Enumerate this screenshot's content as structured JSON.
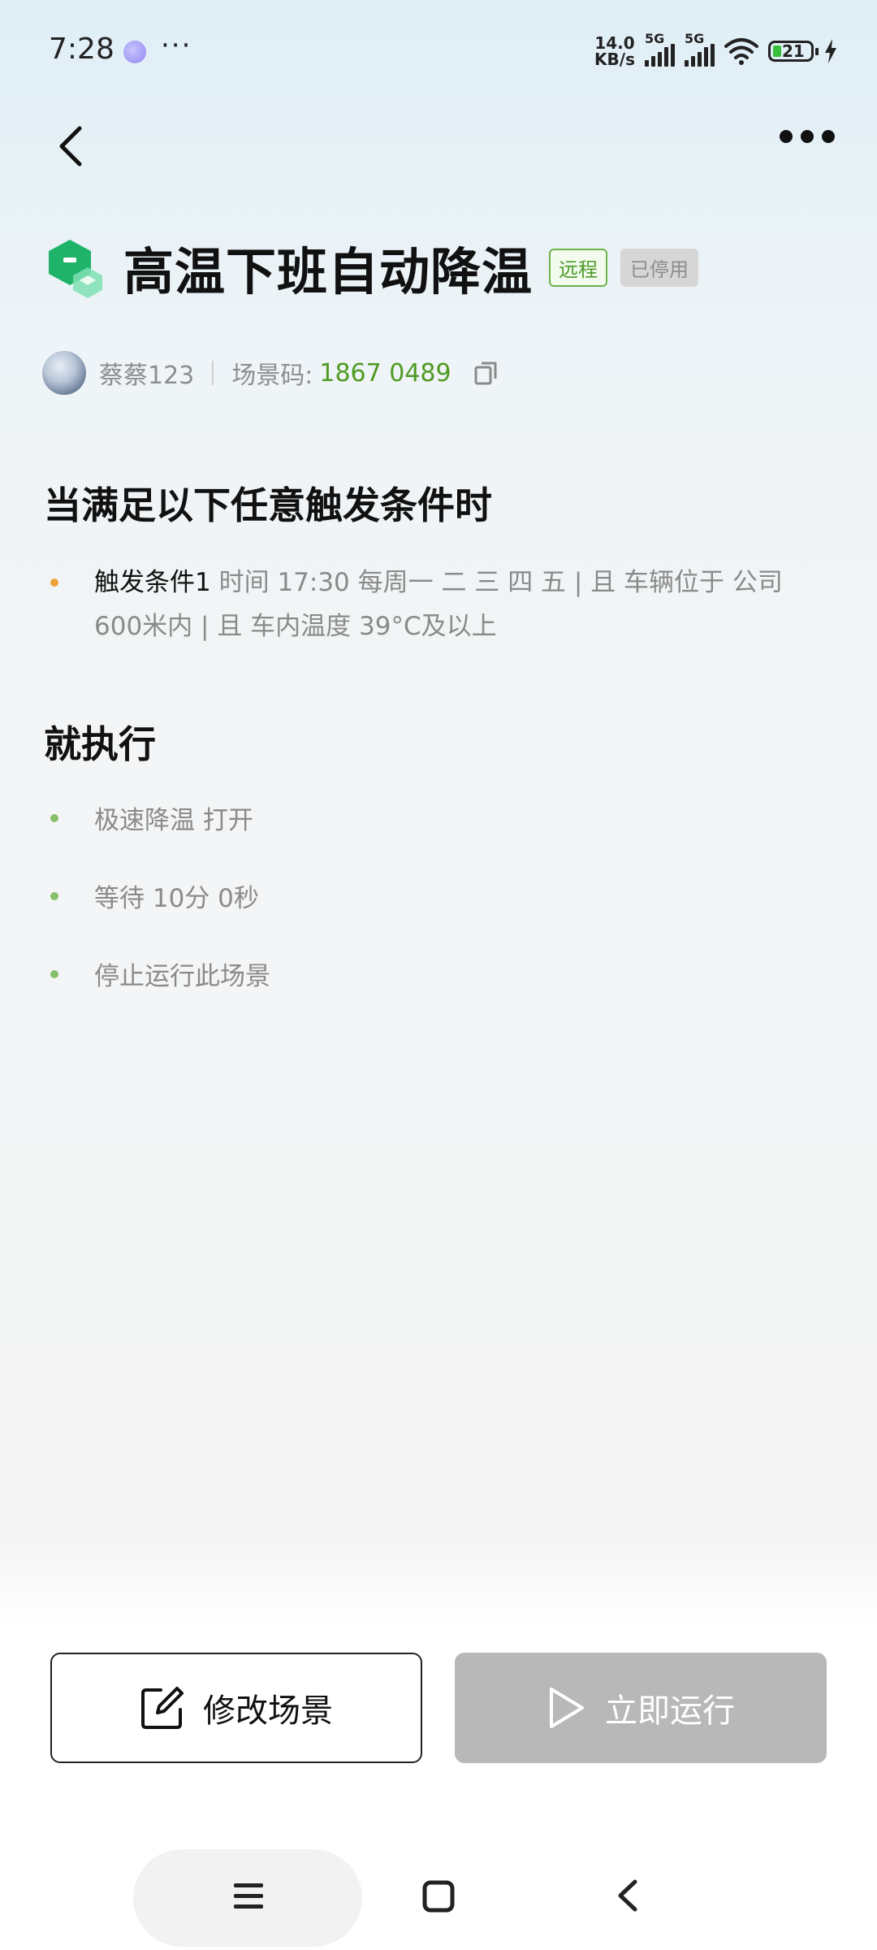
{
  "status_bar": {
    "time": "7:28",
    "more": "···",
    "speed_value": "14.0",
    "speed_unit": "KB/s",
    "network1": "5G",
    "network2": "5G",
    "battery": "21"
  },
  "header": {
    "back_icon": "chevron-left-icon",
    "more_icon": "more-horizontal-icon"
  },
  "scene": {
    "title": "高温下班自动降温",
    "tag_remote": "远程",
    "tag_status": "已停用",
    "owner": "蔡蔡123",
    "code_label": "场景码:",
    "code_value": "1867 0489",
    "accent_color": "#4f9a22"
  },
  "conditions": {
    "heading": "当满足以下任意触发条件时",
    "items": [
      {
        "label": "触发条件1",
        "detail": "时间 17:30 每周一 二 三 四 五 | 且 车辆位于 公司600米内 | 且 车内温度 39°C及以上"
      }
    ]
  },
  "actions": {
    "heading": "就执行",
    "items": [
      {
        "text": "极速降温 打开"
      },
      {
        "text": "等待 10分 0秒"
      },
      {
        "text": "停止运行此场景"
      }
    ]
  },
  "buttons": {
    "edit_label": "修改场景",
    "run_label": "立即运行"
  },
  "nav": {
    "menu_icon": "menu-icon",
    "home_icon": "home-square-icon",
    "back_icon": "back-icon"
  }
}
